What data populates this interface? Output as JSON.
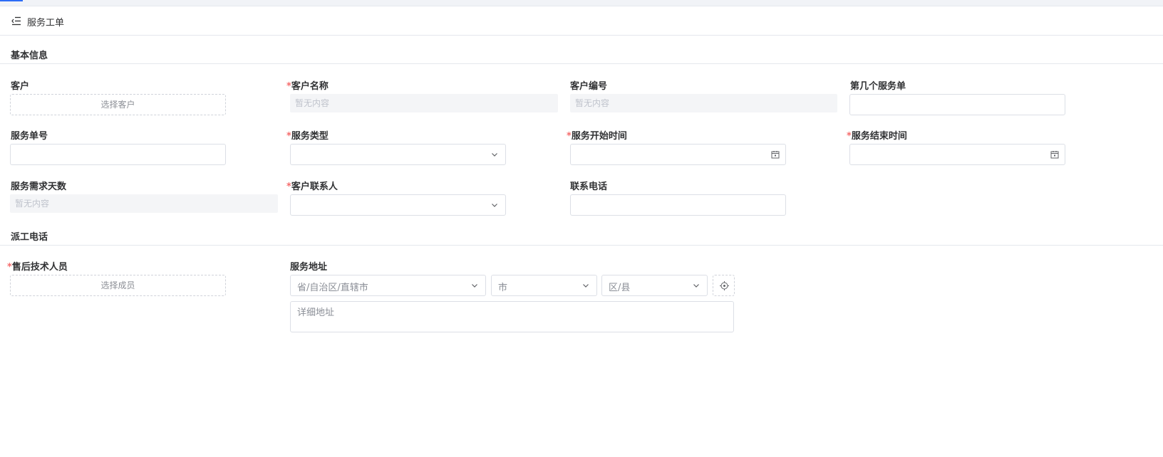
{
  "header": {
    "title": "服务工单",
    "menu_icon": "menu-fold-icon"
  },
  "sections": {
    "basic": "基本信息",
    "dispatch": "派工电话"
  },
  "fields": {
    "customer": {
      "label": "客户",
      "button": "选择客户",
      "required": false
    },
    "customer_name": {
      "label": "客户名称",
      "value": "暂无内容",
      "required": true
    },
    "customer_code": {
      "label": "客户编号",
      "value": "暂无内容",
      "required": false
    },
    "service_seq": {
      "label": "第几个服务单",
      "value": "",
      "required": false
    },
    "service_no": {
      "label": "服务单号",
      "value": "",
      "required": false
    },
    "service_type": {
      "label": "服务类型",
      "value": "",
      "required": true
    },
    "start_time": {
      "label": "服务开始时间",
      "value": "",
      "required": true
    },
    "end_time": {
      "label": "服务结束时间",
      "value": "",
      "required": true
    },
    "demand_days": {
      "label": "服务需求天数",
      "value": "暂无内容",
      "required": false
    },
    "contact_person": {
      "label": "客户联系人",
      "value": "",
      "required": true
    },
    "contact_phone": {
      "label": "联系电话",
      "value": "",
      "required": false
    },
    "technician": {
      "label": "售后技术人员",
      "button": "选择成员",
      "required": true
    },
    "address": {
      "label": "服务地址",
      "province_placeholder": "省/自治区/直辖市",
      "city_placeholder": "市",
      "district_placeholder": "区/县",
      "detail_placeholder": "详细地址",
      "locate_icon": "locate-icon"
    }
  },
  "required_mark": "*",
  "colors": {
    "accent": "#2d6cf6",
    "required": "#f56c6c",
    "border": "#dcdfe6",
    "readonly_bg": "#f4f5f7"
  }
}
